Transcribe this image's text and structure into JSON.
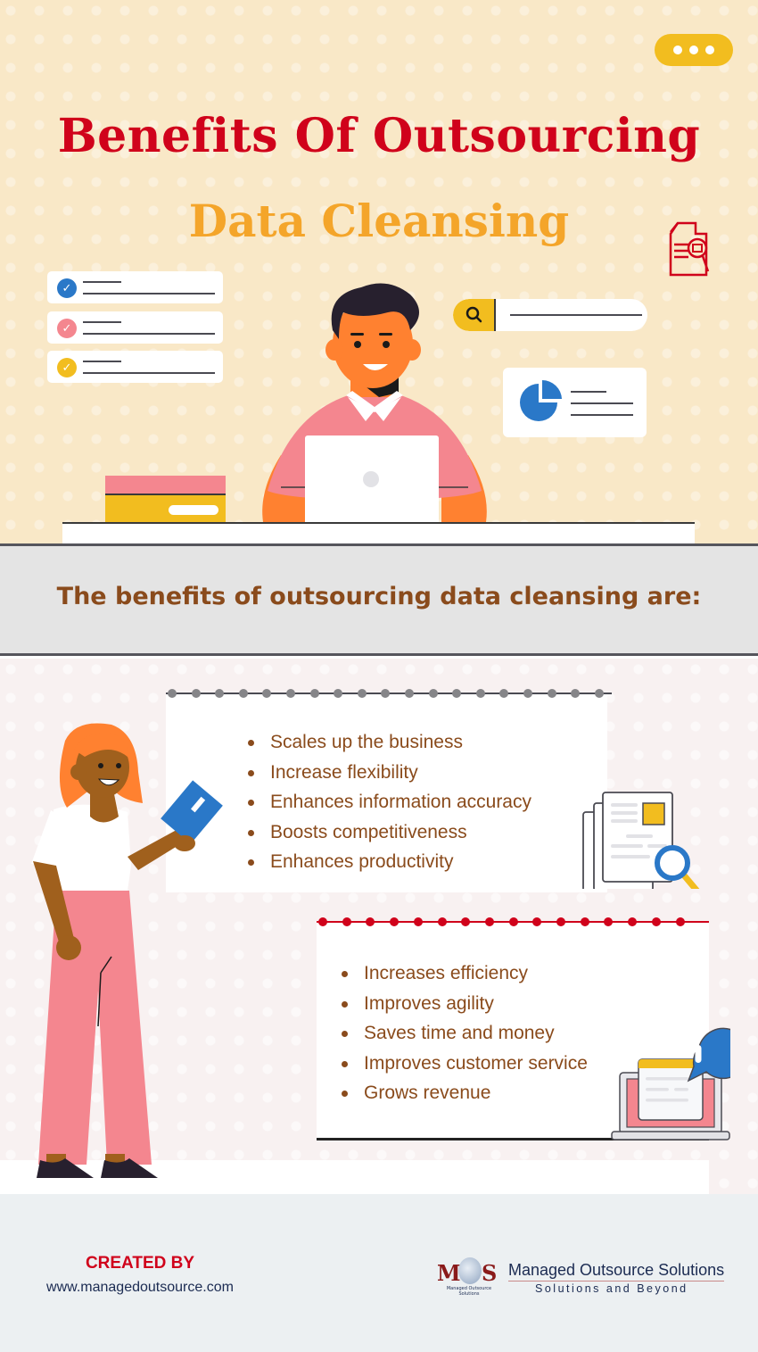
{
  "header": {
    "title_line1": "Benefits Of Outsourcing",
    "title_line2": "Data Cleansing",
    "menu_icon": "ellipsis-icon"
  },
  "illustration": {
    "checklist_items": [
      {
        "icon": "check-circle-icon",
        "color": "#2a78c8"
      },
      {
        "icon": "check-circle-icon",
        "color": "#f4868f"
      },
      {
        "icon": "check-circle-icon",
        "color": "#f2bd1f"
      }
    ],
    "search_icon": "search-icon",
    "pie_icon": "pie-chart-icon",
    "document_search_icon": "document-search-icon"
  },
  "banner": {
    "text": "The benefits of outsourcing data cleansing are:"
  },
  "benefits": {
    "list1": [
      "Scales up the business",
      "Increase flexibility",
      "Enhances information accuracy",
      "Boosts competitiveness",
      "Enhances productivity"
    ],
    "list2": [
      "Increases efficiency",
      "Improves agility",
      "Saves time and money",
      "Improves customer service",
      "Grows revenue"
    ]
  },
  "footer": {
    "created_by": "CREATED BY",
    "url": "www.managedoutsource.com",
    "company_name": "Managed Outsource Solutions",
    "tagline": "Solutions and Beyond",
    "logo_letters": [
      "M",
      "S"
    ],
    "logo_caption": "Managed Outsource Solutions"
  },
  "colors": {
    "title_red": "#d0021b",
    "title_orange": "#f4a52a",
    "text_brown": "#8a4b1c",
    "accent_yellow": "#f2bd1f",
    "accent_pink": "#f4868f",
    "accent_blue": "#2a78c8"
  }
}
